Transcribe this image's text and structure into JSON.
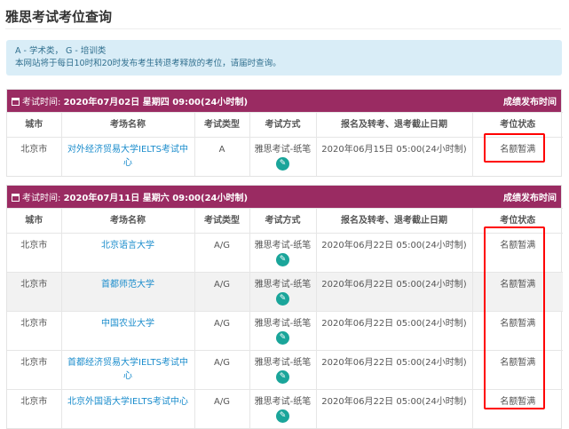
{
  "title": "雅思考试考位查询",
  "info": {
    "line1": "A - 学术类， G - 培训类",
    "line2": "本网站将于每日10时和20时发布考生转退考释放的考位，请届时查询。"
  },
  "columns": [
    "城市",
    "考场名称",
    "考试类型",
    "考试方式",
    "报名及转考、退考截止日期",
    "考位状态"
  ],
  "sessions": [
    {
      "label": "考试时间:",
      "date": "2020年07月02日 星期四 09:00(24小时制)",
      "result_link": "成绩发布时间",
      "rows": [
        {
          "city": "北京市",
          "venue": "对外经济贸易大学IELTS考试中心",
          "type": "A",
          "mode": "雅思考试-纸笔",
          "deadline": "2020年06月15日 05:00(24小时制)",
          "status": "名额暂满"
        }
      ]
    },
    {
      "label": "考试时间:",
      "date": "2020年07月11日 星期六 09:00(24小时制)",
      "result_link": "成绩发布时间",
      "rows": [
        {
          "city": "北京市",
          "venue": "北京语言大学",
          "type": "A/G",
          "mode": "雅思考试-纸笔",
          "deadline": "2020年06月22日 05:00(24小时制)",
          "status": "名额暂满"
        },
        {
          "city": "北京市",
          "venue": "首都师范大学",
          "type": "A/G",
          "mode": "雅思考试-纸笔",
          "deadline": "2020年06月22日 05:00(24小时制)",
          "status": "名额暂满"
        },
        {
          "city": "北京市",
          "venue": "中国农业大学",
          "type": "A/G",
          "mode": "雅思考试-纸笔",
          "deadline": "2020年06月22日 05:00(24小时制)",
          "status": "名额暂满"
        },
        {
          "city": "北京市",
          "venue": "首都经济贸易大学IELTS考试中心",
          "type": "A/G",
          "mode": "雅思考试-纸笔",
          "deadline": "2020年06月22日 05:00(24小时制)",
          "status": "名额暂满"
        },
        {
          "city": "北京市",
          "venue": "北京外国语大学IELTS考试中心",
          "type": "A/G",
          "mode": "雅思考试-纸笔",
          "deadline": "2020年06月22日 05:00(24小时制)",
          "status": "名额暂满"
        }
      ]
    }
  ],
  "colors": {
    "header": "#9a2b62",
    "accent": "#1aa59a",
    "link": "#1a8ccc",
    "highlight": "#ff0000"
  }
}
